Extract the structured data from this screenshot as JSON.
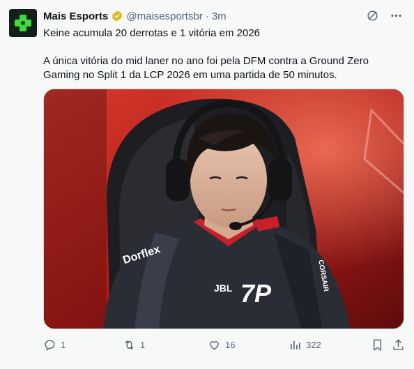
{
  "author": {
    "name": "Mais Esports",
    "handle": "@maisesportsbr",
    "separator": "·",
    "time": "3m"
  },
  "tweet": {
    "line1": "Keine acumula 20 derrotas e 1 vitória em 2026",
    "line2": "A única vitória do mid laner no ano foi pela DFM contra a Ground Zero Gaming no Split 1 da LCP 2026 em uma partida de 50 minutos."
  },
  "media": {
    "jersey_sponsor_left": "Dorflex",
    "jersey_sponsor_center": "JBL",
    "jersey_logo": "7P",
    "jersey_sponsor_right": "CORSAIR"
  },
  "actions": {
    "replies": "1",
    "reposts": "1",
    "likes": "16",
    "views": "322"
  },
  "colors": {
    "brand_green": "#3ddc3d",
    "accent": "#1d9bf0",
    "muted": "#536471",
    "verified_gold": "#e2b719"
  },
  "icons": [
    "reply-icon",
    "repost-icon",
    "like-icon",
    "views-icon",
    "bookmark-icon",
    "share-icon",
    "grok-icon",
    "more-icon",
    "verified-badge-icon"
  ]
}
